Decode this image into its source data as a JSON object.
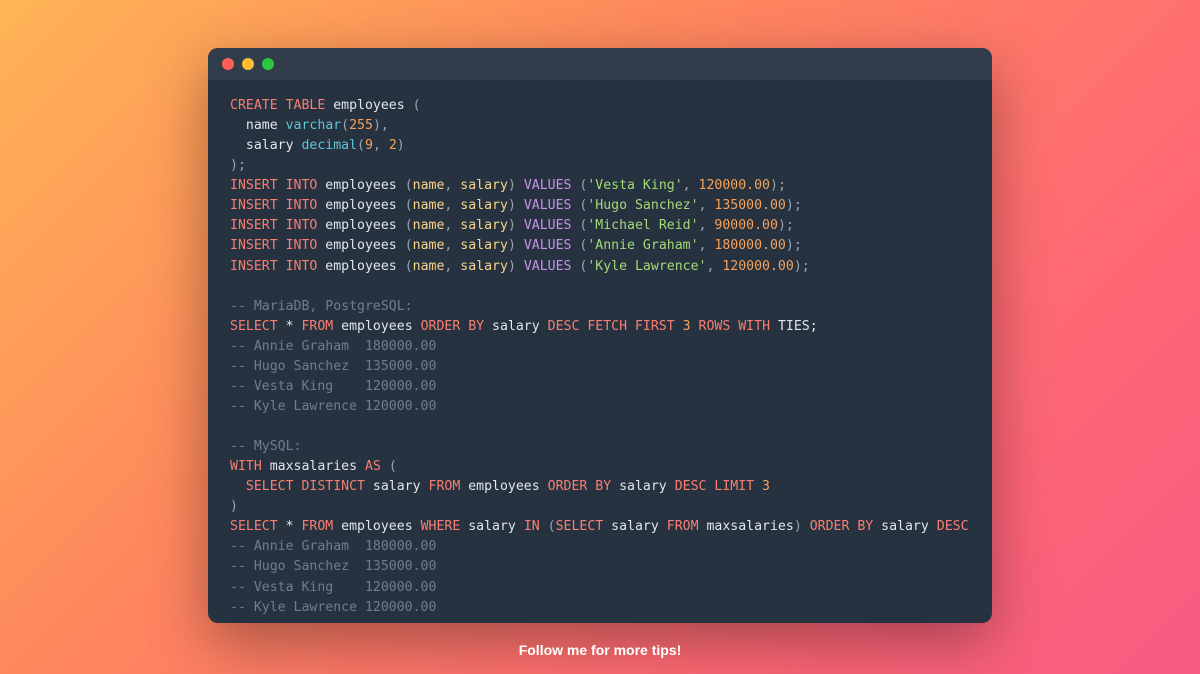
{
  "footer": "Follow me for more tips!",
  "code_lines": [
    [
      {
        "t": "CREATE TABLE",
        "c": "kw"
      },
      {
        "t": " employees ",
        "c": "id"
      },
      {
        "t": "(",
        "c": "punc"
      }
    ],
    [
      {
        "t": "  name ",
        "c": "id"
      },
      {
        "t": "varchar",
        "c": "ty"
      },
      {
        "t": "(",
        "c": "punc"
      },
      {
        "t": "255",
        "c": "num"
      },
      {
        "t": "),",
        "c": "punc"
      }
    ],
    [
      {
        "t": "  salary ",
        "c": "id"
      },
      {
        "t": "decimal",
        "c": "ty"
      },
      {
        "t": "(",
        "c": "punc"
      },
      {
        "t": "9",
        "c": "num"
      },
      {
        "t": ", ",
        "c": "punc"
      },
      {
        "t": "2",
        "c": "num"
      },
      {
        "t": ")",
        "c": "punc"
      }
    ],
    [
      {
        "t": ");",
        "c": "punc"
      }
    ],
    [
      {
        "t": "INSERT INTO",
        "c": "kw"
      },
      {
        "t": " employees ",
        "c": "id"
      },
      {
        "t": "(",
        "c": "punc"
      },
      {
        "t": "name",
        "c": "idc"
      },
      {
        "t": ", ",
        "c": "punc"
      },
      {
        "t": "salary",
        "c": "idc"
      },
      {
        "t": ") ",
        "c": "punc"
      },
      {
        "t": "VALUES",
        "c": "fn"
      },
      {
        "t": " (",
        "c": "punc"
      },
      {
        "t": "'Vesta King'",
        "c": "str"
      },
      {
        "t": ", ",
        "c": "punc"
      },
      {
        "t": "120000.00",
        "c": "num"
      },
      {
        "t": ");",
        "c": "punc"
      }
    ],
    [
      {
        "t": "INSERT INTO",
        "c": "kw"
      },
      {
        "t": " employees ",
        "c": "id"
      },
      {
        "t": "(",
        "c": "punc"
      },
      {
        "t": "name",
        "c": "idc"
      },
      {
        "t": ", ",
        "c": "punc"
      },
      {
        "t": "salary",
        "c": "idc"
      },
      {
        "t": ") ",
        "c": "punc"
      },
      {
        "t": "VALUES",
        "c": "fn"
      },
      {
        "t": " (",
        "c": "punc"
      },
      {
        "t": "'Hugo Sanchez'",
        "c": "str"
      },
      {
        "t": ", ",
        "c": "punc"
      },
      {
        "t": "135000.00",
        "c": "num"
      },
      {
        "t": ");",
        "c": "punc"
      }
    ],
    [
      {
        "t": "INSERT INTO",
        "c": "kw"
      },
      {
        "t": " employees ",
        "c": "id"
      },
      {
        "t": "(",
        "c": "punc"
      },
      {
        "t": "name",
        "c": "idc"
      },
      {
        "t": ", ",
        "c": "punc"
      },
      {
        "t": "salary",
        "c": "idc"
      },
      {
        "t": ") ",
        "c": "punc"
      },
      {
        "t": "VALUES",
        "c": "fn"
      },
      {
        "t": " (",
        "c": "punc"
      },
      {
        "t": "'Michael Reid'",
        "c": "str"
      },
      {
        "t": ", ",
        "c": "punc"
      },
      {
        "t": "90000.00",
        "c": "num"
      },
      {
        "t": ");",
        "c": "punc"
      }
    ],
    [
      {
        "t": "INSERT INTO",
        "c": "kw"
      },
      {
        "t": " employees ",
        "c": "id"
      },
      {
        "t": "(",
        "c": "punc"
      },
      {
        "t": "name",
        "c": "idc"
      },
      {
        "t": ", ",
        "c": "punc"
      },
      {
        "t": "salary",
        "c": "idc"
      },
      {
        "t": ") ",
        "c": "punc"
      },
      {
        "t": "VALUES",
        "c": "fn"
      },
      {
        "t": " (",
        "c": "punc"
      },
      {
        "t": "'Annie Graham'",
        "c": "str"
      },
      {
        "t": ", ",
        "c": "punc"
      },
      {
        "t": "180000.00",
        "c": "num"
      },
      {
        "t": ");",
        "c": "punc"
      }
    ],
    [
      {
        "t": "INSERT INTO",
        "c": "kw"
      },
      {
        "t": " employees ",
        "c": "id"
      },
      {
        "t": "(",
        "c": "punc"
      },
      {
        "t": "name",
        "c": "idc"
      },
      {
        "t": ", ",
        "c": "punc"
      },
      {
        "t": "salary",
        "c": "idc"
      },
      {
        "t": ") ",
        "c": "punc"
      },
      {
        "t": "VALUES",
        "c": "fn"
      },
      {
        "t": " (",
        "c": "punc"
      },
      {
        "t": "'Kyle Lawrence'",
        "c": "str"
      },
      {
        "t": ", ",
        "c": "punc"
      },
      {
        "t": "120000.00",
        "c": "num"
      },
      {
        "t": ");",
        "c": "punc"
      }
    ],
    [],
    [
      {
        "t": "-- MariaDB, PostgreSQL:",
        "c": "cm"
      }
    ],
    [
      {
        "t": "SELECT",
        "c": "kw"
      },
      {
        "t": " * ",
        "c": "id"
      },
      {
        "t": "FROM",
        "c": "kw"
      },
      {
        "t": " employees ",
        "c": "id"
      },
      {
        "t": "ORDER BY",
        "c": "kw"
      },
      {
        "t": " salary ",
        "c": "id"
      },
      {
        "t": "DESC FETCH FIRST",
        "c": "kw"
      },
      {
        "t": " ",
        "c": "id"
      },
      {
        "t": "3",
        "c": "num"
      },
      {
        "t": " ",
        "c": "id"
      },
      {
        "t": "ROWS WITH",
        "c": "kw"
      },
      {
        "t": " TIES;",
        "c": "id"
      }
    ],
    [
      {
        "t": "-- Annie Graham  180000.00",
        "c": "cm"
      }
    ],
    [
      {
        "t": "-- Hugo Sanchez  135000.00",
        "c": "cm"
      }
    ],
    [
      {
        "t": "-- Vesta King    120000.00",
        "c": "cm"
      }
    ],
    [
      {
        "t": "-- Kyle Lawrence 120000.00",
        "c": "cm"
      }
    ],
    [],
    [
      {
        "t": "-- MySQL:",
        "c": "cm"
      }
    ],
    [
      {
        "t": "WITH",
        "c": "kw"
      },
      {
        "t": " maxsalaries ",
        "c": "id"
      },
      {
        "t": "AS",
        "c": "kw"
      },
      {
        "t": " (",
        "c": "punc"
      }
    ],
    [
      {
        "t": "  ",
        "c": "id"
      },
      {
        "t": "SELECT DISTINCT",
        "c": "kw"
      },
      {
        "t": " salary ",
        "c": "id"
      },
      {
        "t": "FROM",
        "c": "kw"
      },
      {
        "t": " employees ",
        "c": "id"
      },
      {
        "t": "ORDER BY",
        "c": "kw"
      },
      {
        "t": " salary ",
        "c": "id"
      },
      {
        "t": "DESC LIMIT",
        "c": "kw"
      },
      {
        "t": " ",
        "c": "id"
      },
      {
        "t": "3",
        "c": "num"
      }
    ],
    [
      {
        "t": ")",
        "c": "punc"
      }
    ],
    [
      {
        "t": "SELECT",
        "c": "kw"
      },
      {
        "t": " * ",
        "c": "id"
      },
      {
        "t": "FROM",
        "c": "kw"
      },
      {
        "t": " employees ",
        "c": "id"
      },
      {
        "t": "WHERE",
        "c": "kw"
      },
      {
        "t": " salary ",
        "c": "id"
      },
      {
        "t": "IN",
        "c": "kw"
      },
      {
        "t": " (",
        "c": "punc"
      },
      {
        "t": "SELECT",
        "c": "kw"
      },
      {
        "t": " salary ",
        "c": "id"
      },
      {
        "t": "FROM",
        "c": "kw"
      },
      {
        "t": " maxsalaries",
        "c": "id"
      },
      {
        "t": ") ",
        "c": "punc"
      },
      {
        "t": "ORDER BY",
        "c": "kw"
      },
      {
        "t": " salary ",
        "c": "id"
      },
      {
        "t": "DESC",
        "c": "kw"
      }
    ],
    [
      {
        "t": "-- Annie Graham  180000.00",
        "c": "cm"
      }
    ],
    [
      {
        "t": "-- Hugo Sanchez  135000.00",
        "c": "cm"
      }
    ],
    [
      {
        "t": "-- Vesta King    120000.00",
        "c": "cm"
      }
    ],
    [
      {
        "t": "-- Kyle Lawrence 120000.00",
        "c": "cm"
      }
    ]
  ]
}
